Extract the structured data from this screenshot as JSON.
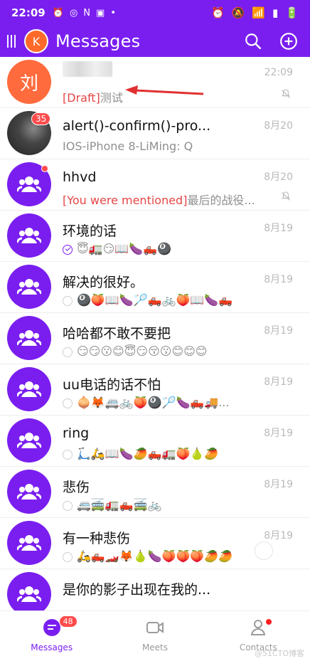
{
  "status_bar": {
    "time": "22:09"
  },
  "header": {
    "avatar_letter": "K",
    "title": "Messages"
  },
  "accent_color": "#7a1ef0",
  "conversations": [
    {
      "avatar_text": "刘",
      "avatar_type": "person",
      "title": "",
      "sub_prefix": "[Draft]",
      "sub_text": "测试",
      "date": "22:09",
      "muted": true
    },
    {
      "avatar_text": "",
      "avatar_type": "photo",
      "badge": "35",
      "title": "alert()-confirm()-pro...",
      "sub_text": "IOS-iPhone 8-LiMing: Q",
      "date": "8月20"
    },
    {
      "avatar_type": "group",
      "dot": true,
      "title": "hhvd",
      "sub_prefix": "[You were mentioned]",
      "sub_text": "最后的战役...",
      "date": "8月20",
      "muted": true
    },
    {
      "avatar_type": "group",
      "title": "环境的话",
      "sub_text": "😇🚛😏📖🍆🛻🎱",
      "date": "8月19",
      "read": true
    },
    {
      "avatar_type": "group",
      "title": "解决的很好。",
      "sub_text": "🎱🍑📖🍆🏸🛻🚲🍑📖🍆🛻",
      "date": "8月19"
    },
    {
      "avatar_type": "group",
      "title": "哈哈都不敢不要把",
      "sub_text": "😏😏😗😊😇😏😚😗😊😊😊",
      "date": "8月19"
    },
    {
      "avatar_type": "group",
      "title": "uu电话的话不怕",
      "sub_text": "🧅🦊🚐🚲🍑🎱🏸🍆🛻🚚...",
      "date": "8月19"
    },
    {
      "avatar_type": "group",
      "title": "ring",
      "sub_text": "🛴🛵📖🍆🥭🛻🚛🍑🍐🥭",
      "date": "8月19"
    },
    {
      "avatar_type": "group",
      "title": "悲伤",
      "sub_text": "🚐🚎🚛🛻🚎🚲",
      "date": "8月19"
    },
    {
      "avatar_type": "group",
      "title": "有一种悲伤",
      "sub_text": "🛵🛻🏎️🦊🍐🍆🍑🍑🍑🥭🥭",
      "date": "8月19"
    },
    {
      "avatar_type": "group",
      "title": "是你的影子出现在我的...",
      "sub_text": "",
      "date": ""
    }
  ],
  "nav": {
    "messages_label": "Messages",
    "messages_badge": "48",
    "meets_label": "Meets",
    "contacts_label": "Contacts"
  },
  "watermark": "@51CTO博客"
}
